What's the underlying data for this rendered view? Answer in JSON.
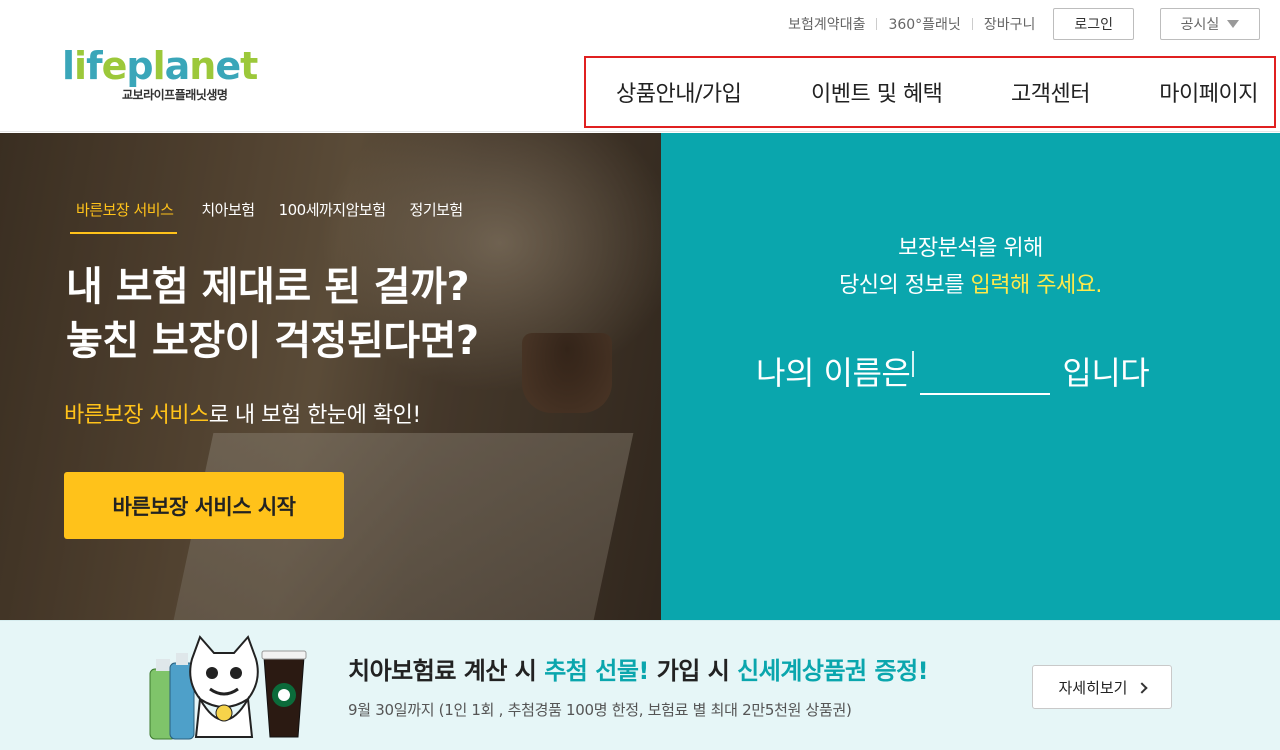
{
  "header": {
    "logo": {
      "wordmark": "lifeplanet",
      "subtitle": "교보라이프플래닛생명"
    },
    "util_links": [
      "보험계약대출",
      "360°플래닛",
      "장바구니"
    ],
    "login_label": "로그인",
    "notice_label": "공시실",
    "gnb": [
      "상품안내/가입",
      "이벤트 및 혜택",
      "고객센터",
      "마이페이지"
    ]
  },
  "hero": {
    "tabs": [
      "바른보장 서비스",
      "치아보험",
      "100세까지암보험",
      "정기보험"
    ],
    "active_tab": "바른보장 서비스",
    "title_line1": "내 보험 제대로 된 걸까?",
    "title_line2": "놓친 보장이 걱정된다면?",
    "sub_highlight": "바른보장 서비스",
    "sub_rest": "로 내 보험 한눈에 확인!",
    "cta_label": "바른보장 서비스 시작"
  },
  "form": {
    "line1": "보장분석을 위해",
    "line2_prefix": "당신의 정보를 ",
    "line2_highlight": "입력해 주세요.",
    "name_prefix": "나의 이름은",
    "name_value": "",
    "name_suffix": "입니다"
  },
  "banner": {
    "title_a": "치아보험료 계산 시 ",
    "title_b": "추첨 선물!",
    "title_c": " 가입 시 ",
    "title_d": "신세계상품권 증정!",
    "desc": "9월 30일까지 (1인 1회 , 추첨경품 100명 한정, 보험료 별 최대 2만5천원 상품권)",
    "more_label": "자세히보기"
  },
  "colors": {
    "brand_teal": "#0aa6ad",
    "accent_yellow": "#ffc21a",
    "highlight_yellow": "#ffe94a",
    "gnb_highlight_border": "#e02020"
  }
}
